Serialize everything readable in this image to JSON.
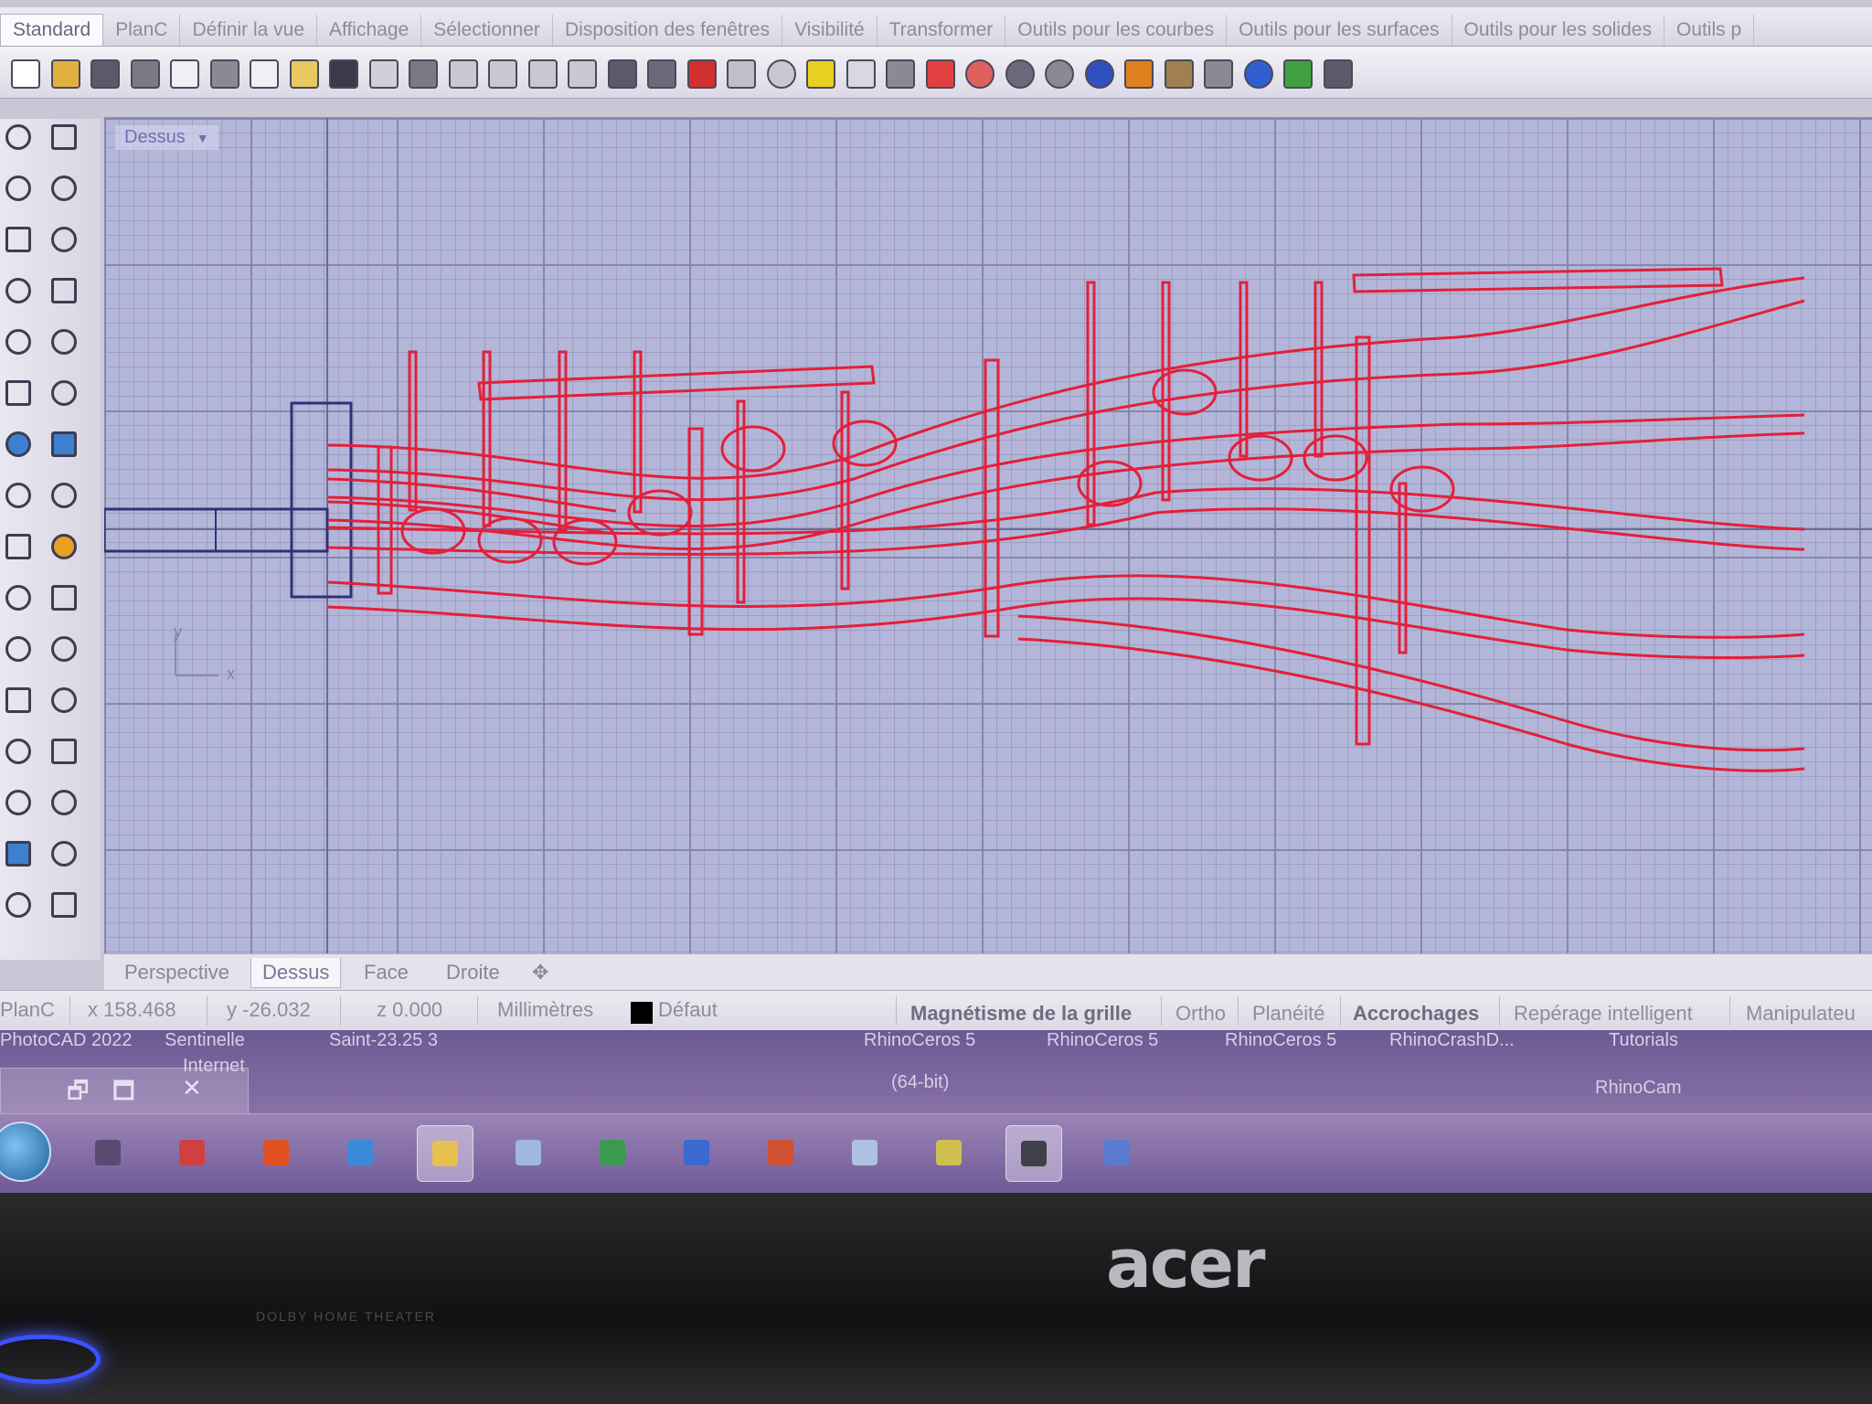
{
  "tabs": [
    "Standard",
    "PlanC",
    "Définir la vue",
    "Affichage",
    "Sélectionner",
    "Disposition des fenêtres",
    "Visibilité",
    "Transformer",
    "Outils pour les courbes",
    "Outils pour les surfaces",
    "Outils pour les solides",
    "Outils p"
  ],
  "toolbar_icons": [
    {
      "name": "new-icon",
      "color": "#ffffff"
    },
    {
      "name": "open-icon",
      "color": "#e0b040"
    },
    {
      "name": "save-icon",
      "color": "#5a5a6a"
    },
    {
      "name": "print-icon",
      "color": "#7a7a86"
    },
    {
      "name": "import-icon",
      "color": "#f0f0f4"
    },
    {
      "name": "cut-icon",
      "color": "#8a8a96"
    },
    {
      "name": "copy-icon",
      "color": "#f0f0f4"
    },
    {
      "name": "paste-icon",
      "color": "#e8c860"
    },
    {
      "name": "undo-icon",
      "color": "#3a3a4a"
    },
    {
      "name": "pan-hand-icon",
      "color": "#d0d0d8"
    },
    {
      "name": "move-view-icon",
      "color": "#7a7a86"
    },
    {
      "name": "zoom-icon",
      "color": "#c8c8d0"
    },
    {
      "name": "zoom-window-icon",
      "color": "#c8c8d0"
    },
    {
      "name": "zoom-extents-icon",
      "color": "#c8c8d0"
    },
    {
      "name": "zoom-selected-icon",
      "color": "#c8c8d0"
    },
    {
      "name": "rotate-view-icon",
      "color": "#5a5a6a"
    },
    {
      "name": "viewport-layout-icon",
      "color": "#6a6a7a"
    },
    {
      "name": "set-view-icon",
      "color": "#d03030"
    },
    {
      "name": "shade-icon",
      "color": "#c0c0c8"
    },
    {
      "name": "clock-icon",
      "color": "#c8c8d0"
    },
    {
      "name": "points-icon",
      "color": "#e8d020"
    },
    {
      "name": "light-bulb-icon",
      "color": "#d8d8e0"
    },
    {
      "name": "lock-icon",
      "color": "#8a8a96"
    },
    {
      "name": "layer-icon",
      "color": "#e04040"
    },
    {
      "name": "color-wheel-icon",
      "color": "#e06060"
    },
    {
      "name": "wireframe-sphere-icon",
      "color": "#6a6a7a"
    },
    {
      "name": "shaded-sphere-icon",
      "color": "#8a8a96"
    },
    {
      "name": "render-sphere-icon",
      "color": "#3050c0"
    },
    {
      "name": "dimension-icon",
      "color": "#e08020"
    },
    {
      "name": "options-gear-icon",
      "color": "#a08050"
    },
    {
      "name": "grid-snap-icon",
      "color": "#8a8a96"
    },
    {
      "name": "help-icon",
      "color": "#3060d0"
    },
    {
      "name": "plugin-icon",
      "color": "#40a040"
    },
    {
      "name": "gumball-icon",
      "color": "#5a5a6a"
    }
  ],
  "left_tools": [
    "select-arrow-icon",
    "point-icon",
    "polyline-icon",
    "rectangle-tool-icon",
    "circle-icon",
    "ellipse-icon",
    "polygon-icon",
    "box-outline-icon",
    "arc-icon",
    "curve-icon",
    "surface-icon",
    "extrude-icon",
    "solid-box-icon",
    "sphere-solid-icon",
    "cylinder-icon",
    "plane-surface-icon",
    "boolean-icon",
    "explode-icon",
    "trim-icon",
    "split-icon",
    "fillet-icon",
    "join-icon",
    "offset-icon",
    "blend-icon",
    "text-icon",
    "scale-icon",
    "array-icon",
    "mirror-icon",
    "block-icon",
    "measure-icon",
    "grid-dots-icon",
    "more-icon"
  ],
  "viewport": {
    "title": "Dessus",
    "axis_y": "y",
    "axis_x": "x"
  },
  "view_tabs": [
    "Perspective",
    "Dessus",
    "Face",
    "Droite",
    "✥"
  ],
  "status": {
    "plane": "PlanC",
    "x": "x 158.468",
    "y": "y -26.032",
    "z": "z 0.000",
    "units": "Millimètres",
    "layer": "Défaut",
    "toggles": [
      "Magnétisme de la grille",
      "Ortho",
      "Planéité",
      "Accrochages",
      "Repérage intelligent",
      "Manipulateu"
    ]
  },
  "desktop_labels": [
    "PhotoCAD 2022",
    "Sentinelle",
    "Saint-23.25 3",
    "Internet",
    "RhinoCeros 5",
    "(64-bit)",
    "RhinoCeros 5",
    "RhinoCeros 5",
    "RhinoCrashD...",
    "Tutorials",
    "RhinoCam"
  ],
  "window_controls": [
    "🗗",
    "🗖",
    "✕"
  ],
  "taskbar_icons": [
    {
      "name": "media-icon",
      "color": "#5a4a70"
    },
    {
      "name": "paint-icon",
      "color": "#d04040"
    },
    {
      "name": "office-icon",
      "color": "#e05020"
    },
    {
      "name": "internet-explorer-icon",
      "color": "#3a8ad8"
    },
    {
      "name": "explorer-folder-icon",
      "color": "#e8c050"
    },
    {
      "name": "document-icon",
      "color": "#a0b8e0"
    },
    {
      "name": "excel-icon",
      "color": "#3a9a50"
    },
    {
      "name": "word-icon",
      "color": "#3a6ad0"
    },
    {
      "name": "powerpoint-icon",
      "color": "#d05030"
    },
    {
      "name": "notepad-icon",
      "color": "#b0c0e0"
    },
    {
      "name": "notes-icon",
      "color": "#d0c050"
    },
    {
      "name": "rhino-icon",
      "color": "#40404a"
    },
    {
      "name": "app-icon",
      "color": "#5a7ad0"
    }
  ],
  "brand": "acer",
  "subbrand": "DOLBY HOME THEATER"
}
